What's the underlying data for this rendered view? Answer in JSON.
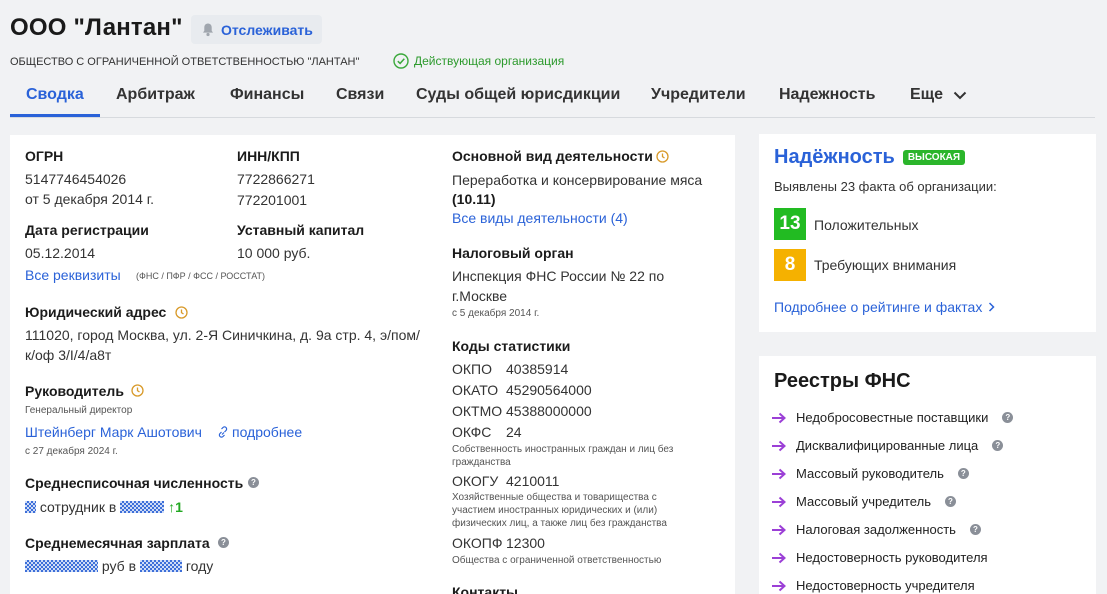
{
  "header": {
    "title": "ООО \"Лантан\"",
    "follow_label": "Отслеживать",
    "full_name": "ОБЩЕСТВО С ОГРАНИЧЕННОЙ ОТВЕТСТВЕННОСТЬЮ \"ЛАНТАН\"",
    "status": "Действующая организация"
  },
  "tabs": [
    "Сводка",
    "Арбитраж",
    "Финансы",
    "Связи",
    "Суды общей юрисдикции",
    "Учредители",
    "Надежность",
    "Еще"
  ],
  "main": {
    "ogrn_label": "ОГРН",
    "ogrn_value": "5147746454026",
    "ogrn_date": "от 5 декабря 2014 г.",
    "inn_label": "ИНН/КПП",
    "inn_value": "7722866271",
    "kpp_value": "772201001",
    "reg_date_label": "Дата регистрации",
    "reg_date_value": "05.12.2014",
    "capital_label": "Уставный капитал",
    "capital_value": "10 000 руб.",
    "all_details_link": "Все реквизиты",
    "all_details_note": "(ФНС / ПФР / ФСС / РОССТАТ)",
    "address_label": "Юридический адрес",
    "address_line1": "111020, город Москва, ул. 2-Я Синичкина, д. 9а стр. 4, э/пом/",
    "address_line2": "к/оф 3/I/4/а8т",
    "director_label": "Руководитель",
    "director_position": "Генеральный директор",
    "director_name": "Штейнберг Марк Ашотович",
    "director_more": "подробнее",
    "director_date": "с 27 декабря 2024 г.",
    "headcount_label": "Среднесписочная численность",
    "headcount_text": "сотрудник в",
    "headcount_delta": "1",
    "salary_label": "Среднемесячная зарплата",
    "salary_mid": "руб в",
    "salary_end": "году",
    "activity_label": "Основной вид деятельности",
    "activity_line1": "Переработка и консервирование мяса",
    "activity_code": "(10.11)",
    "activity_all_link": "Все виды деятельности (4)",
    "tax_label": "Налоговый орган",
    "tax_line1": "Инспекция ФНС России № 22 по",
    "tax_line2": "г.Москве",
    "tax_date": "с 5 декабря 2014 г.",
    "stats_label": "Коды статистики",
    "okpo_code": "ОКПО",
    "okpo_value": "40385914",
    "okato_code": "ОКАТО",
    "okato_value": "45290564000",
    "oktmo_code": "ОКТМО",
    "oktmo_value": "45388000000",
    "okfs_code": "ОКФС",
    "okfs_value": "24",
    "okfs_note1": "Собственность иностранных граждан и лиц без",
    "okfs_note2": "гражданства",
    "okogu_code": "ОКОГУ",
    "okogu_value": "4210011",
    "okogu_note1": "Хозяйственные общества и товарищества с",
    "okogu_note2": "участием иностранных юридических и (или)",
    "okogu_note3": "физических лиц, а также лиц без гражданства",
    "okopf_code": "ОКОПФ",
    "okopf_value": "12300",
    "okopf_note": "Общества с ограниченной ответственностью",
    "contacts_label": "Контакты"
  },
  "reliability": {
    "title": "Надёжность",
    "badge": "ВЫСОКАЯ",
    "summary": "Выявлены 23 факта об организации:",
    "positive_count": "13",
    "positive_label": "Положительных",
    "attention_count": "8",
    "attention_label": "Требующих внимания",
    "more_link": "Подробнее о рейтинге и фактах",
    "colors": {
      "positive": "#22bb22",
      "attention": "#f5b100",
      "title": "#2a62d8"
    }
  },
  "registries": {
    "title": "Реестры ФНС",
    "items": [
      "Недобросовестные поставщики",
      "Дисквалифицированные лица",
      "Массовый руководитель",
      "Массовый учредитель",
      "Налоговая задолженность",
      "Недостоверность руководителя",
      "Недостоверность учредителя"
    ]
  }
}
